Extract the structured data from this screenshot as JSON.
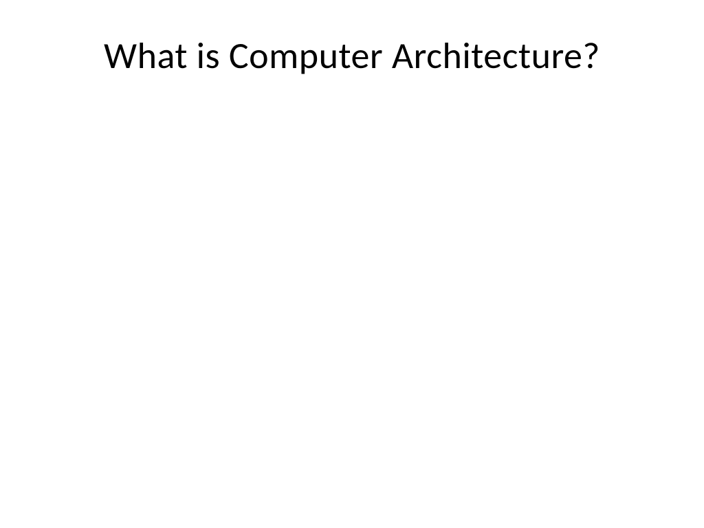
{
  "slide": {
    "title": "What is Computer Architecture?"
  }
}
